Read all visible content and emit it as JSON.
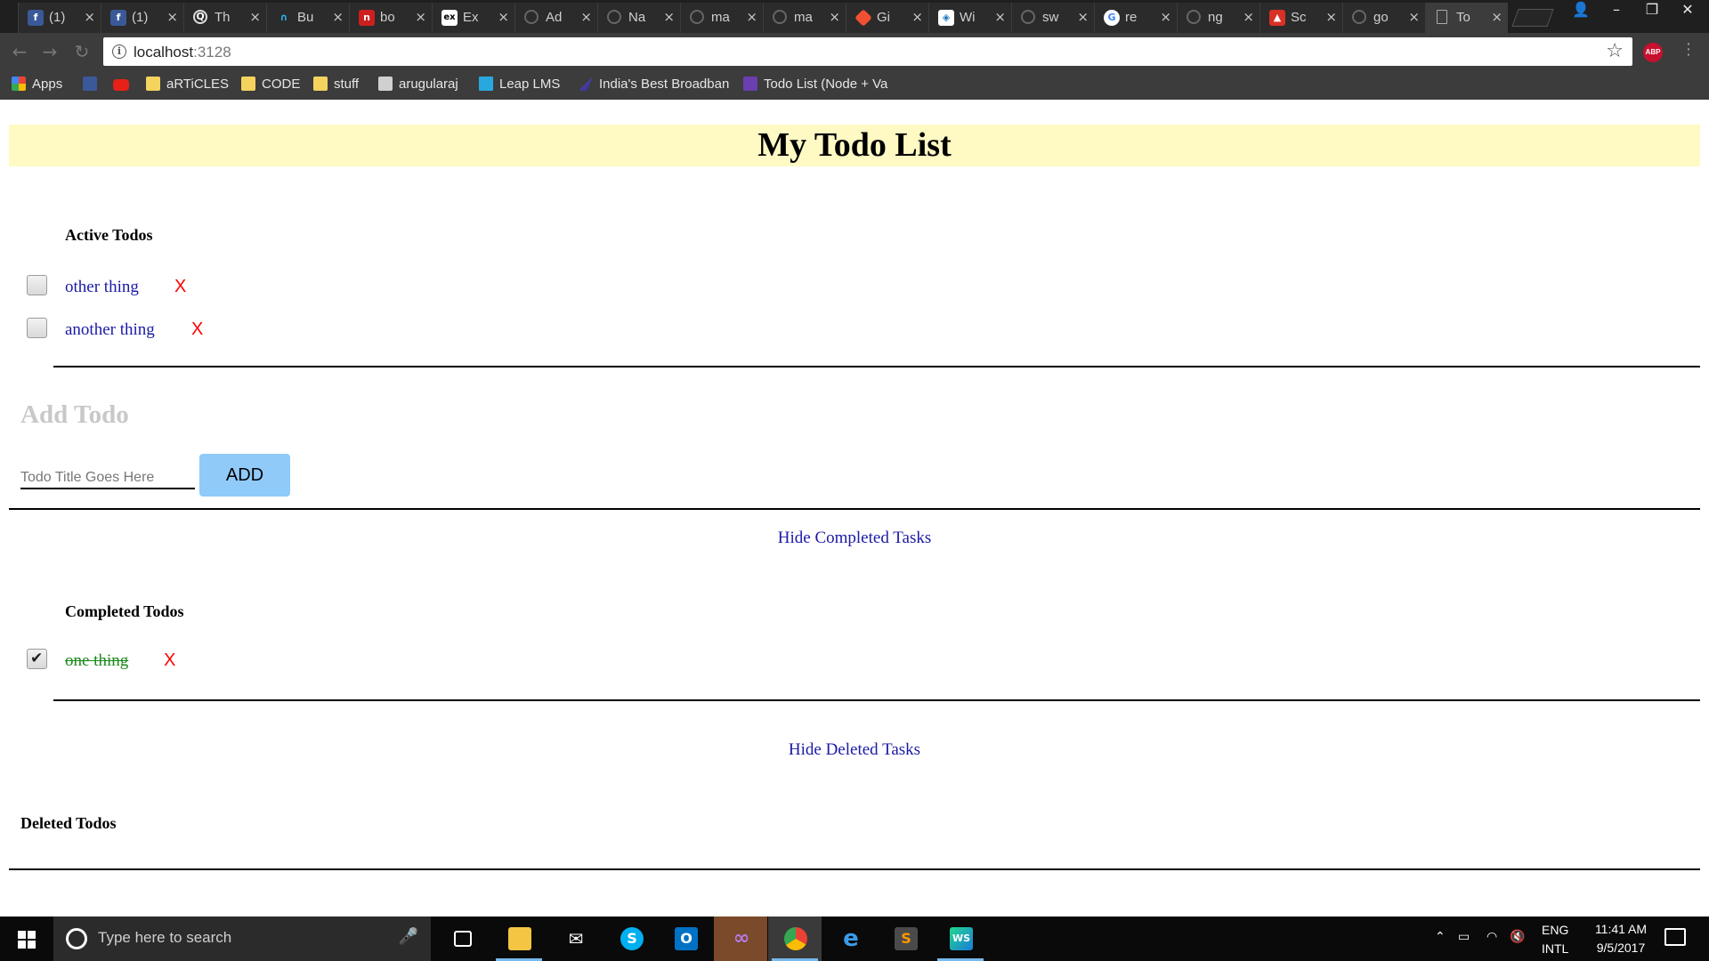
{
  "browser": {
    "tabs": [
      {
        "icon": "facebook-icon",
        "title": "(1)",
        "color": "#3b5998",
        "glyph": "f"
      },
      {
        "icon": "facebook-icon",
        "title": "(1)",
        "color": "#3b5998",
        "glyph": "f"
      },
      {
        "icon": "quora-icon",
        "title": "Th",
        "color": "#1f1f1f",
        "glyph": "Q"
      },
      {
        "icon": "headphones-icon",
        "title": "Bu",
        "color": "#1f1f1f",
        "glyph": "∩"
      },
      {
        "icon": "bookmark-red-icon",
        "title": "bo",
        "color": "#cc1f1f",
        "glyph": "n"
      },
      {
        "icon": "express-icon",
        "title": "Ex",
        "color": "#ffffff",
        "glyph": "ex"
      },
      {
        "icon": "github-icon",
        "title": "Ad",
        "color": "#1f1f1f",
        "glyph": "○"
      },
      {
        "icon": "github-icon",
        "title": "Na",
        "color": "#1f1f1f",
        "glyph": "○"
      },
      {
        "icon": "github-icon",
        "title": "ma",
        "color": "#1f1f1f",
        "glyph": "○"
      },
      {
        "icon": "github-icon",
        "title": "ma",
        "color": "#1f1f1f",
        "glyph": "○"
      },
      {
        "icon": "git-icon",
        "title": "Gi",
        "color": "#f05032",
        "glyph": "◆"
      },
      {
        "icon": "webpack-icon",
        "title": "Wi",
        "color": "#ffffff",
        "glyph": "◈"
      },
      {
        "icon": "github-icon",
        "title": "sw",
        "color": "#1f1f1f",
        "glyph": "○"
      },
      {
        "icon": "google-icon",
        "title": "re",
        "color": "#ffffff",
        "glyph": "G"
      },
      {
        "icon": "github-icon",
        "title": "ng",
        "color": "#1f1f1f",
        "glyph": "○"
      },
      {
        "icon": "image-icon",
        "title": "Sc",
        "color": "#d93025",
        "glyph": "▲"
      },
      {
        "icon": "github-icon",
        "title": "go",
        "color": "#1f1f1f",
        "glyph": "○"
      },
      {
        "icon": "page-icon",
        "title": "To",
        "color": "#3c3c3c",
        "glyph": "▯"
      }
    ],
    "address": {
      "host": "localhost",
      "port": ":3128"
    },
    "bookmarks": [
      {
        "label": "Apps",
        "icon": "apps-grid-icon"
      },
      {
        "label": "",
        "icon": "facebook-icon"
      },
      {
        "label": "",
        "icon": "youtube-icon"
      },
      {
        "label": "aRTiCLES",
        "icon": "folder-icon"
      },
      {
        "label": "CODE",
        "icon": "folder-icon"
      },
      {
        "label": "stuff",
        "icon": "folder-icon"
      },
      {
        "label": "arugularaj",
        "icon": "stackexchange-icon"
      },
      {
        "label": "Leap LMS",
        "icon": "leap-icon"
      },
      {
        "label": "India's Best Broadban",
        "icon": "broadband-icon"
      },
      {
        "label": "Todo List (Node + Va",
        "icon": "list-icon"
      }
    ]
  },
  "page": {
    "title": "My Todo List",
    "active_heading": "Active Todos",
    "active_todos": [
      {
        "text": "other thing",
        "delete": "X"
      },
      {
        "text": "another thing",
        "delete": "X"
      }
    ],
    "add_heading": "Add Todo",
    "add_placeholder": "Todo Title Goes Here",
    "add_button": "ADD",
    "hide_completed": "Hide Completed Tasks",
    "completed_heading": "Completed Todos",
    "completed_todos": [
      {
        "text": "one thing",
        "delete": "X"
      }
    ],
    "hide_deleted": "Hide Deleted Tasks",
    "deleted_heading": "Deleted Todos"
  },
  "taskbar": {
    "search_placeholder": "Type here to search",
    "lang_top": "ENG",
    "lang_bottom": "INTL",
    "time": "11:41 AM",
    "date": "9/5/2017"
  },
  "colors": {
    "title_bg": "#fff9c4",
    "link": "#1a1aa6",
    "done": "#1a8a1a",
    "delete": "#ff0000",
    "add_button": "#90caf9"
  }
}
